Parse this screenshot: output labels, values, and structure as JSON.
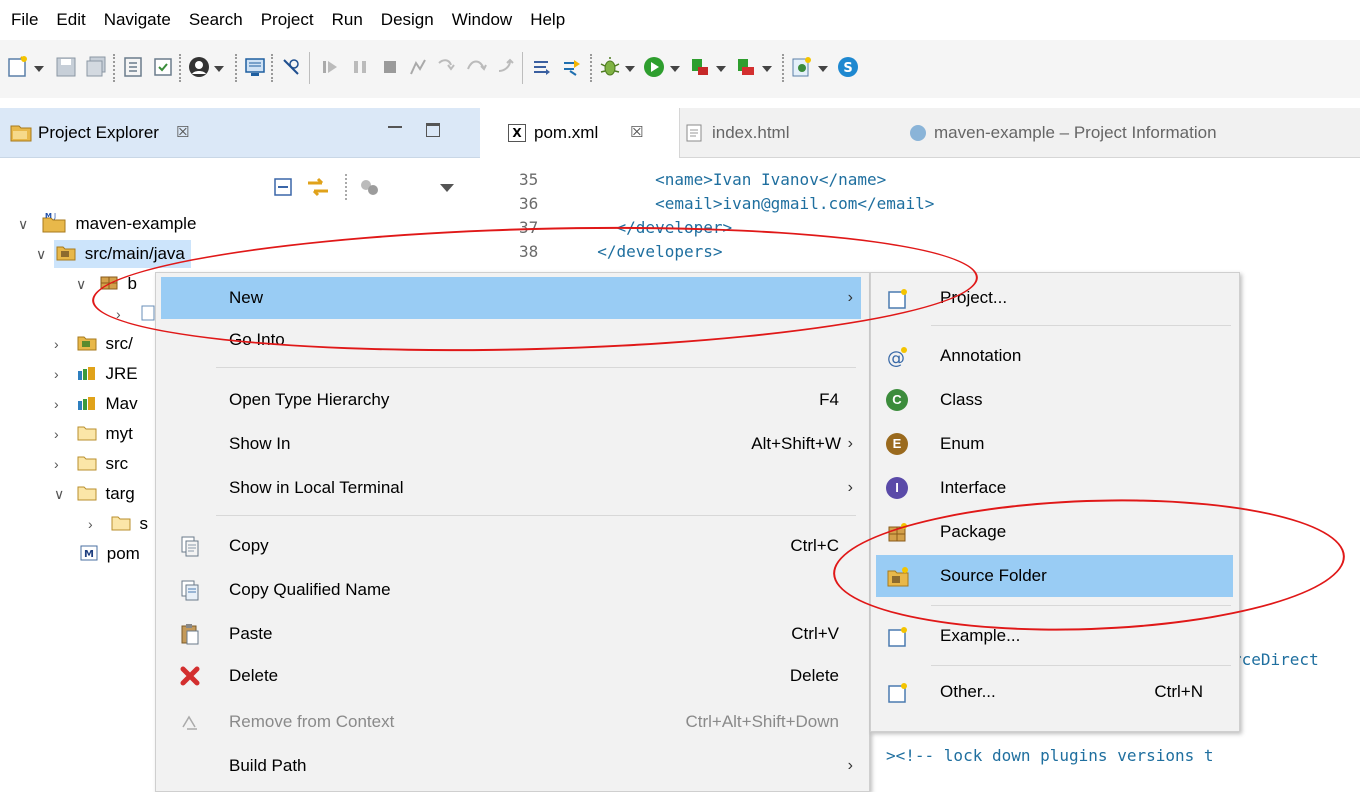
{
  "menubar": {
    "items": [
      "File",
      "Edit",
      "Navigate",
      "Search",
      "Project",
      "Run",
      "Design",
      "Window",
      "Help"
    ]
  },
  "toolbar": {
    "icons": [
      "new-wizard-icon",
      "save-icon",
      "save-all-icon",
      "outline-icon",
      "open-task-icon",
      "user-icon",
      "terminal-icon",
      "breakpoint-icon",
      "resume-icon",
      "suspend-icon",
      "terminate-icon",
      "disconnect-icon",
      "step-into-icon",
      "step-over-icon",
      "step-return-icon",
      "use-step-filters-icon",
      "refactor-icon",
      "debug-icon",
      "run-icon",
      "external-tools-icon",
      "coverage-icon",
      "new-class-icon",
      "new-source-icon"
    ]
  },
  "explorer": {
    "title": "Project Explorer",
    "tree": [
      {
        "label": "maven-example",
        "level": 0,
        "icon": "maven-project-icon",
        "expanded": true
      },
      {
        "label": "src/main/java",
        "level": 1,
        "icon": "source-folder-icon",
        "expanded": true,
        "selected": true
      },
      {
        "label": "b",
        "level": 2,
        "icon": "package-icon",
        "expanded": true
      },
      {
        "label": "",
        "level": 3,
        "icon": "java-file-icon",
        "expanded": false
      },
      {
        "label": "src/",
        "level": 1,
        "icon": "source-folder-icon",
        "expanded": false
      },
      {
        "label": "JRE",
        "level": 1,
        "icon": "library-icon",
        "expanded": false
      },
      {
        "label": "Mav",
        "level": 1,
        "icon": "library-icon",
        "expanded": false
      },
      {
        "label": "myt",
        "level": 1,
        "icon": "folder-icon",
        "expanded": false
      },
      {
        "label": "src",
        "level": 1,
        "icon": "folder-icon",
        "expanded": false
      },
      {
        "label": "targ",
        "level": 1,
        "icon": "folder-icon",
        "expanded": true
      },
      {
        "label": "s",
        "level": 2,
        "icon": "folder-icon",
        "expanded": false
      },
      {
        "label": "pom",
        "level": 1,
        "icon": "maven-pom-icon",
        "expanded": null
      }
    ]
  },
  "editor": {
    "tabs": [
      {
        "label": "pom.xml",
        "active": true
      },
      {
        "label": "index.html",
        "active": false
      },
      {
        "label": "maven-example – Project Information",
        "active": false
      }
    ],
    "lines": [
      {
        "num": "35",
        "text": "        <name>Ivan Ivanov</name>"
      },
      {
        "num": "36",
        "text": "        <email>ivan@gmail.com</email>"
      },
      {
        "num": "37",
        "text": "    </developer>"
      },
      {
        "num": "38",
        "text": "  </developers>"
      }
    ],
    "partial_right_1": "rceDirect",
    "partial_right_2": "><!-- lock down plugins versions t"
  },
  "context_menu": {
    "items": [
      {
        "label": "New",
        "shortcut": "",
        "arrow": true,
        "highlighted": true,
        "icon": ""
      },
      {
        "label": "Go Into",
        "shortcut": "",
        "arrow": false,
        "icon": ""
      },
      {
        "label": "Open Type Hierarchy",
        "shortcut": "F4",
        "arrow": false,
        "icon": ""
      },
      {
        "label": "Show In",
        "shortcut": "Alt+Shift+W",
        "arrow": true,
        "icon": ""
      },
      {
        "label": "Show in Local Terminal",
        "shortcut": "",
        "arrow": true,
        "icon": ""
      },
      {
        "label": "Copy",
        "shortcut": "Ctrl+C",
        "arrow": false,
        "icon": "copy-icon"
      },
      {
        "label": "Copy Qualified Name",
        "shortcut": "",
        "arrow": false,
        "icon": "copy-qualified-icon"
      },
      {
        "label": "Paste",
        "shortcut": "Ctrl+V",
        "arrow": false,
        "icon": "paste-icon"
      },
      {
        "label": "Delete",
        "shortcut": "Delete",
        "arrow": false,
        "icon": "delete-icon"
      },
      {
        "label": "Remove from Context",
        "shortcut": "Ctrl+Alt+Shift+Down",
        "arrow": false,
        "disabled": true,
        "icon": "remove-context-icon"
      },
      {
        "label": "Build Path",
        "shortcut": "",
        "arrow": true,
        "icon": ""
      }
    ]
  },
  "submenu": {
    "items": [
      {
        "label": "Project...",
        "shortcut": "",
        "icon": "new-project-icon"
      },
      {
        "label": "Annotation",
        "shortcut": "",
        "icon": "annotation-icon"
      },
      {
        "label": "Class",
        "shortcut": "",
        "icon": "class-icon"
      },
      {
        "label": "Enum",
        "shortcut": "",
        "icon": "enum-icon"
      },
      {
        "label": "Interface",
        "shortcut": "",
        "icon": "interface-icon"
      },
      {
        "label": "Package",
        "shortcut": "",
        "icon": "package-icon"
      },
      {
        "label": "Source Folder",
        "shortcut": "",
        "icon": "source-folder-icon",
        "highlighted": true
      },
      {
        "label": "Example...",
        "shortcut": "",
        "icon": "example-icon"
      },
      {
        "label": "Other...",
        "shortcut": "Ctrl+N",
        "icon": "other-wizard-icon"
      }
    ]
  },
  "colors": {
    "highlight": "#99ccf4",
    "annotation_circle": "#e01818",
    "explorer_tab": "#dbe8f7"
  }
}
